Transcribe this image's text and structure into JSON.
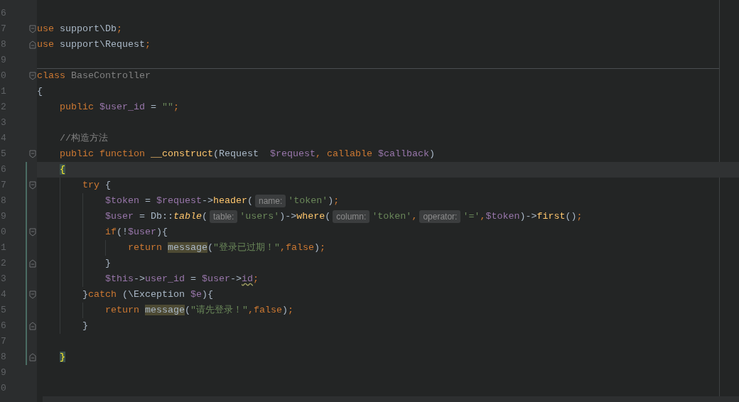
{
  "lines": [
    {
      "number": "6",
      "fold_start": false,
      "fold_end": false,
      "changed": false,
      "current": false,
      "separator_above": false
    },
    {
      "number": "7",
      "fold_start": true,
      "fold_end": false,
      "changed": false,
      "current": false,
      "separator_above": false,
      "tokens": [
        {
          "kind": "keyword",
          "text": "use"
        },
        {
          "kind": "plain",
          "text": " support\\Db"
        },
        {
          "kind": "punct",
          "text": ";"
        }
      ]
    },
    {
      "number": "8",
      "fold_start": false,
      "fold_end": true,
      "changed": false,
      "current": false,
      "separator_above": false,
      "tokens": [
        {
          "kind": "keyword",
          "text": "use"
        },
        {
          "kind": "plain",
          "text": " support\\Request"
        },
        {
          "kind": "punct",
          "text": ";"
        }
      ]
    },
    {
      "number": "9",
      "fold_start": false,
      "fold_end": false,
      "changed": false,
      "current": false,
      "separator_above": false
    },
    {
      "number": "0",
      "fold_start": true,
      "fold_end": false,
      "changed": false,
      "current": false,
      "separator_above": true,
      "tokens": [
        {
          "kind": "keyword",
          "text": "class"
        },
        {
          "kind": "unused",
          "text": " BaseController"
        }
      ]
    },
    {
      "number": "1",
      "fold_start": false,
      "fold_end": false,
      "changed": false,
      "current": false,
      "separator_above": false,
      "tokens": [
        {
          "kind": "plain",
          "text": "{"
        }
      ]
    },
    {
      "number": "2",
      "fold_start": false,
      "fold_end": false,
      "changed": false,
      "current": false,
      "separator_above": false,
      "tokens": [
        {
          "kind": "keyword",
          "text": "    public"
        },
        {
          "kind": "variable",
          "text": " $user_id"
        },
        {
          "kind": "plain",
          "text": " = "
        },
        {
          "kind": "string",
          "text": "\"\""
        },
        {
          "kind": "punct",
          "text": ";"
        }
      ]
    },
    {
      "number": "3",
      "fold_start": false,
      "fold_end": false,
      "changed": false,
      "current": false,
      "separator_above": false
    },
    {
      "number": "4",
      "fold_start": false,
      "fold_end": false,
      "changed": false,
      "current": false,
      "separator_above": false,
      "tokens": [
        {
          "kind": "comment",
          "text": "    //构造方法"
        }
      ]
    },
    {
      "number": "5",
      "fold_start": true,
      "fold_end": false,
      "changed": false,
      "current": false,
      "separator_above": false,
      "tokens": [
        {
          "kind": "keyword",
          "text": "    public function"
        },
        {
          "kind": "call",
          "text": " __construct"
        },
        {
          "kind": "plain",
          "text": "(Request  "
        },
        {
          "kind": "variable",
          "text": "$request"
        },
        {
          "kind": "punct",
          "text": ","
        },
        {
          "kind": "keyword",
          "text": " callable"
        },
        {
          "kind": "variable",
          "text": " $callback"
        },
        {
          "kind": "plain",
          "text": ")"
        }
      ]
    },
    {
      "number": "6",
      "fold_start": false,
      "fold_end": false,
      "changed": true,
      "current": true,
      "separator_above": false,
      "tokens": [
        {
          "kind": "brace-match",
          "text": "    {"
        }
      ]
    },
    {
      "number": "7",
      "fold_start": true,
      "fold_end": false,
      "changed": true,
      "current": false,
      "separator_above": false,
      "tokens": [
        {
          "kind": "keyword",
          "text": "        try"
        },
        {
          "kind": "plain",
          "text": " {"
        }
      ]
    },
    {
      "number": "8",
      "fold_start": false,
      "fold_end": false,
      "changed": true,
      "current": false,
      "separator_above": false,
      "tokens": [
        {
          "kind": "variable",
          "text": "            $token"
        },
        {
          "kind": "plain",
          "text": " = "
        },
        {
          "kind": "variable",
          "text": "$request"
        },
        {
          "kind": "plain",
          "text": "->"
        },
        {
          "kind": "call",
          "text": "header"
        },
        {
          "kind": "plain",
          "text": "("
        },
        {
          "kind": "hint",
          "text": "name:"
        },
        {
          "kind": "string",
          "text": "'token'"
        },
        {
          "kind": "plain",
          "text": ")"
        },
        {
          "kind": "punct",
          "text": ";"
        }
      ]
    },
    {
      "number": "9",
      "fold_start": false,
      "fold_end": false,
      "changed": true,
      "current": false,
      "separator_above": false,
      "tokens": [
        {
          "kind": "variable",
          "text": "            $user"
        },
        {
          "kind": "plain",
          "text": " = Db::"
        },
        {
          "kind": "static-call",
          "text": "table"
        },
        {
          "kind": "plain",
          "text": "("
        },
        {
          "kind": "hint",
          "text": "table:"
        },
        {
          "kind": "string",
          "text": "'users'"
        },
        {
          "kind": "plain",
          "text": ")->"
        },
        {
          "kind": "call",
          "text": "where"
        },
        {
          "kind": "plain",
          "text": "("
        },
        {
          "kind": "hint",
          "text": "column:"
        },
        {
          "kind": "string",
          "text": "'token'"
        },
        {
          "kind": "punct",
          "text": ","
        },
        {
          "kind": "hint",
          "text": "operator:"
        },
        {
          "kind": "string",
          "text": "'='"
        },
        {
          "kind": "punct",
          "text": ","
        },
        {
          "kind": "variable",
          "text": "$token"
        },
        {
          "kind": "plain",
          "text": ")->"
        },
        {
          "kind": "call",
          "text": "first"
        },
        {
          "kind": "plain",
          "text": "()"
        },
        {
          "kind": "punct",
          "text": ";"
        }
      ]
    },
    {
      "number": "0",
      "fold_start": true,
      "fold_end": false,
      "changed": true,
      "current": false,
      "separator_above": false,
      "tokens": [
        {
          "kind": "keyword",
          "text": "            if"
        },
        {
          "kind": "plain",
          "text": "(!"
        },
        {
          "kind": "variable",
          "text": "$user"
        },
        {
          "kind": "plain",
          "text": "){"
        }
      ]
    },
    {
      "number": "1",
      "fold_start": false,
      "fold_end": false,
      "changed": true,
      "current": false,
      "separator_above": false,
      "tokens": [
        {
          "kind": "keyword",
          "text": "                return"
        },
        {
          "kind": "usage",
          "text": " message"
        },
        {
          "kind": "plain",
          "text": "("
        },
        {
          "kind": "string",
          "text": "\"登录已过期！\""
        },
        {
          "kind": "punct",
          "text": ","
        },
        {
          "kind": "keyword",
          "text": "false"
        },
        {
          "kind": "plain",
          "text": ")"
        },
        {
          "kind": "punct",
          "text": ";"
        }
      ]
    },
    {
      "number": "2",
      "fold_start": false,
      "fold_end": true,
      "changed": true,
      "current": false,
      "separator_above": false,
      "tokens": [
        {
          "kind": "plain",
          "text": "            }"
        }
      ]
    },
    {
      "number": "3",
      "fold_start": false,
      "fold_end": false,
      "changed": true,
      "current": false,
      "separator_above": false,
      "tokens": [
        {
          "kind": "variable",
          "text": "            $this"
        },
        {
          "kind": "plain",
          "text": "->"
        },
        {
          "kind": "variable",
          "text": "user_id"
        },
        {
          "kind": "plain",
          "text": " = "
        },
        {
          "kind": "variable",
          "text": "$user"
        },
        {
          "kind": "plain",
          "text": "->"
        },
        {
          "kind": "warning",
          "text": "id"
        },
        {
          "kind": "punct",
          "text": ";"
        }
      ]
    },
    {
      "number": "4",
      "fold_start": true,
      "fold_end": false,
      "changed": true,
      "current": false,
      "separator_above": false,
      "tokens": [
        {
          "kind": "plain",
          "text": "        }"
        },
        {
          "kind": "keyword",
          "text": "catch"
        },
        {
          "kind": "plain",
          "text": " (\\Exception "
        },
        {
          "kind": "variable",
          "text": "$e"
        },
        {
          "kind": "plain",
          "text": "){"
        }
      ]
    },
    {
      "number": "5",
      "fold_start": false,
      "fold_end": false,
      "changed": true,
      "current": false,
      "separator_above": false,
      "tokens": [
        {
          "kind": "keyword",
          "text": "            return"
        },
        {
          "kind": "usage",
          "text": " message"
        },
        {
          "kind": "plain",
          "text": "("
        },
        {
          "kind": "string",
          "text": "\"请先登录！\""
        },
        {
          "kind": "punct",
          "text": ","
        },
        {
          "kind": "keyword",
          "text": "false"
        },
        {
          "kind": "plain",
          "text": ")"
        },
        {
          "kind": "punct",
          "text": ";"
        }
      ]
    },
    {
      "number": "6",
      "fold_start": false,
      "fold_end": true,
      "changed": true,
      "current": false,
      "separator_above": false,
      "tokens": [
        {
          "kind": "plain",
          "text": "        }"
        }
      ]
    },
    {
      "number": "7",
      "fold_start": false,
      "fold_end": false,
      "changed": true,
      "current": false,
      "separator_above": false
    },
    {
      "number": "8",
      "fold_start": false,
      "fold_end": true,
      "changed": true,
      "current": false,
      "separator_above": false,
      "tokens": [
        {
          "kind": "brace-match",
          "text": "    }"
        }
      ]
    },
    {
      "number": "9",
      "fold_start": false,
      "fold_end": false,
      "changed": false,
      "current": false,
      "separator_above": false
    },
    {
      "number": "0",
      "fold_start": false,
      "fold_end": false,
      "changed": false,
      "current": false,
      "separator_above": false
    }
  ]
}
